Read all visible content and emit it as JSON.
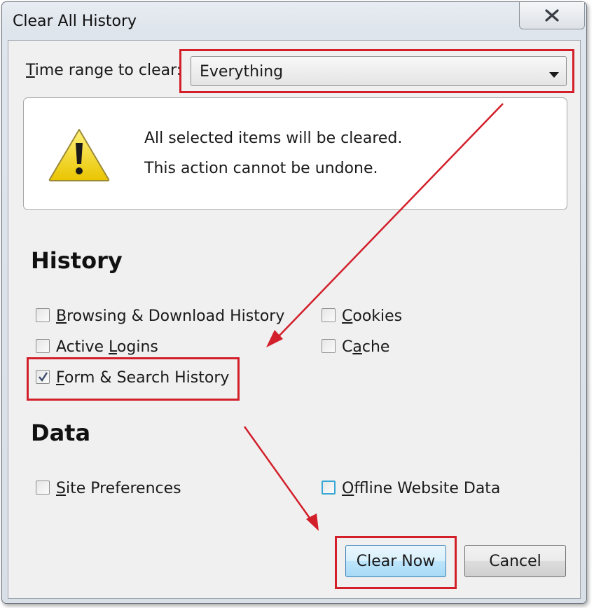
{
  "window": {
    "title": "Clear All History"
  },
  "time_range": {
    "label_prefix": "T",
    "label_rest": "ime range to clear:",
    "selected": "Everything"
  },
  "warning": {
    "line1": "All selected items will be cleared.",
    "line2": "This action cannot be undone."
  },
  "history": {
    "heading": "History",
    "items": [
      {
        "mn": "B",
        "rest": "rowsing & Download History",
        "checked": false
      },
      {
        "pre": "Active ",
        "mn": "L",
        "rest": "ogins",
        "checked": false
      },
      {
        "mn": "F",
        "rest": "orm & Search History",
        "checked": true
      },
      {
        "mn": "C",
        "rest": "ookies",
        "checked": false
      },
      {
        "pre": "C",
        "mn": "a",
        "rest": "che",
        "checked": false
      }
    ]
  },
  "data": {
    "heading": "Data",
    "items": [
      {
        "mn": "S",
        "rest": "ite Preferences",
        "checked": false
      },
      {
        "mn": "O",
        "rest": "ffline Website Data",
        "checked": false
      }
    ]
  },
  "buttons": {
    "clear_now": "Clear Now",
    "cancel": "Cancel"
  },
  "colors": {
    "annotation_red": "#d21f2a",
    "focus_blue": "#39a7d4"
  },
  "icons": {
    "close": "close-icon",
    "warning": "warning-icon",
    "dropdown": "chevron-down-icon",
    "check": "check-icon"
  }
}
